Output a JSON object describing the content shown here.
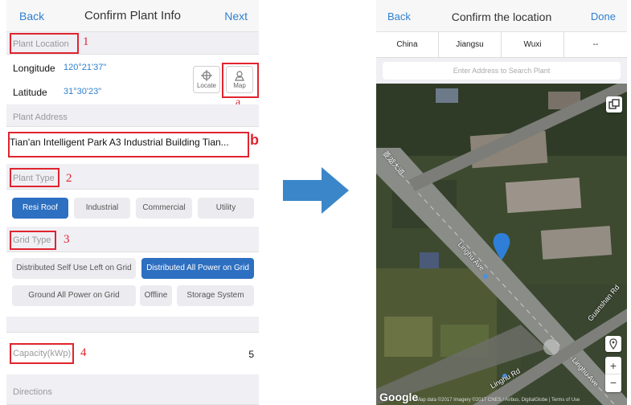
{
  "left_screen": {
    "nav": {
      "back": "Back",
      "title": "Confirm Plant Info",
      "next": "Next"
    },
    "plant_location": {
      "label": "Plant Location",
      "marker": "1"
    },
    "longitude": {
      "label": "Longitude",
      "value": "120°21'37\""
    },
    "latitude": {
      "label": "Latitude",
      "value": "31°30'23\""
    },
    "locate_button": "Locate",
    "map_button": "Map",
    "map_marker": "a",
    "plant_address": {
      "label": "Plant Address",
      "value": "Tian'an Intelligent Park A3 Industrial Building Tian...",
      "marker": "b"
    },
    "plant_type": {
      "label": "Plant Type",
      "marker": "2",
      "options": [
        "Resi Roof",
        "Industrial",
        "Commercial",
        "Utility"
      ],
      "selected": "Resi Roof"
    },
    "grid_type": {
      "label": "Grid Type",
      "marker": "3",
      "options": [
        "Distributed Self Use Left on Grid",
        "Distributed All Power on Grid",
        "Ground All Power on Grid",
        "Offline",
        "Storage System"
      ],
      "selected": "Distributed All Power on Grid"
    },
    "capacity": {
      "label": "Capacity(kWp)",
      "value": "5",
      "marker": "4"
    },
    "directions": {
      "label": "Directions"
    }
  },
  "right_screen": {
    "nav": {
      "back": "Back",
      "title": "Confirm the location",
      "done": "Done"
    },
    "regions": [
      "China",
      "Jiangsu",
      "Wuxi",
      "--"
    ],
    "search_placeholder": "Enter Address to Search Plant",
    "map": {
      "road_labels": [
        "Linghu Ave",
        "Linghu Ave",
        "Guanshan Rd",
        "Linghu Rd",
        "菱湖大道"
      ],
      "zoom_in": "+",
      "zoom_out": "−",
      "google": "Google",
      "attribution": "Map data ©2017 Imagery ©2017 CNES / Airbus, DigitalGlobe | Terms of Use"
    }
  },
  "colors": {
    "accent": "#2f80d1",
    "selected_chip": "#2d6fc0",
    "annotation_red": "#e0242e",
    "arrow": "#3a86c8",
    "map_pin": "#2f7fd8"
  },
  "icons": [
    "crosshair-icon",
    "map-pin-icon",
    "layers-icon",
    "location-icon",
    "arrow-right-icon"
  ]
}
